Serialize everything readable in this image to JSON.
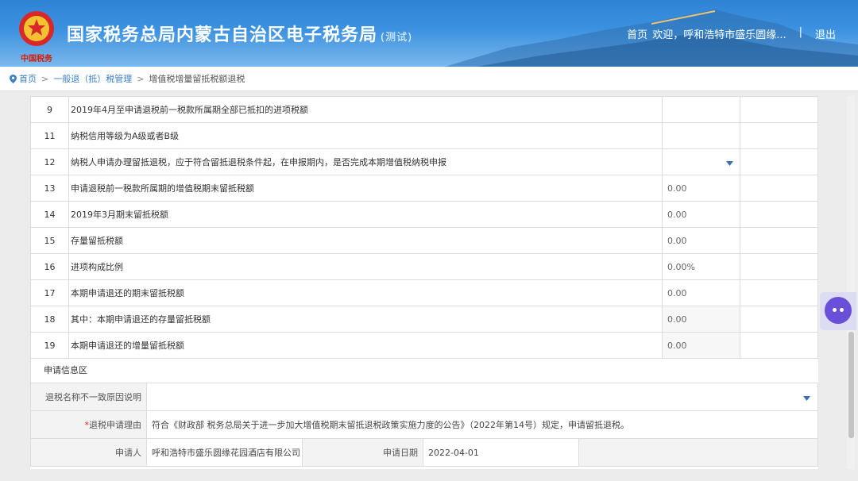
{
  "header": {
    "title": "国家税务总局内蒙古自治区电子税务局",
    "test_label": "(测试)",
    "slogan": "中国税务",
    "nav": {
      "home": "首页",
      "welcome": "欢迎，呼和浩特市盛乐圆缘...",
      "separator": "|",
      "logout": "退出"
    }
  },
  "breadcrumb": {
    "home": "首页",
    "level1": "一般退（抵）税管理",
    "current": "增值税增量留抵税额退税",
    "sep": ">"
  },
  "rows": [
    {
      "num": "9",
      "desc": "2019年4月至申请退税前一税款所属期全部已抵扣的进项税额",
      "value": "",
      "dropdown": false,
      "gray": false
    },
    {
      "num": "11",
      "desc": "纳税信用等级为A级或者B级",
      "value": "",
      "dropdown": false,
      "gray": false
    },
    {
      "num": "12",
      "desc": "纳税人申请办理留抵退税，应于符合留抵退税条件起，在申报期内，是否完成本期增值税纳税申报",
      "value": "",
      "dropdown": true,
      "gray": false
    },
    {
      "num": "13",
      "desc": "申请退税前一税款所属期的增值税期末留抵税额",
      "value": "0.00",
      "dropdown": false,
      "gray": false
    },
    {
      "num": "14",
      "desc": "2019年3月期末留抵税额",
      "value": "0.00",
      "dropdown": false,
      "gray": false
    },
    {
      "num": "15",
      "desc": "存量留抵税额",
      "value": "0.00",
      "dropdown": false,
      "gray": false
    },
    {
      "num": "16",
      "desc": "进项构成比例",
      "value": "0.00%",
      "dropdown": false,
      "gray": false
    },
    {
      "num": "17",
      "desc": "本期申请退还的期末留抵税额",
      "value": "0.00",
      "dropdown": false,
      "gray": false
    },
    {
      "num": "18",
      "desc": "其中：本期申请退还的存量留抵税额",
      "value": "0.00",
      "dropdown": false,
      "gray": true
    },
    {
      "num": "19",
      "desc": "本期申请退还的增量留抵税额",
      "value": "0.00",
      "dropdown": false,
      "gray": true
    }
  ],
  "application": {
    "section_title": "申请信息区",
    "mismatch_label": "退税名称不一致原因说明",
    "mismatch_value": "",
    "required_mark": "*",
    "reason_label": "退税申请理由",
    "reason_value": "符合《财政部 税务总局关于进一步加大增值税期末留抵退税政策实施力度的公告》（2022年第14号）规定，申请留抵退税。",
    "applicant_label": "申请人",
    "applicant_value": "呼和浩特市盛乐圆缘花园酒店有限公司",
    "date_label": "申请日期",
    "date_value": "2022-04-01"
  },
  "icons": {
    "dropdown": "chevron-down-icon",
    "location": "location-pin-icon",
    "assistant": "robot-assistant-icon"
  },
  "colors": {
    "header_blue": "#3c92e0",
    "link_blue": "#3a7fc6",
    "required_red": "#e02020",
    "assistant_purple": "#6a4fd8"
  }
}
